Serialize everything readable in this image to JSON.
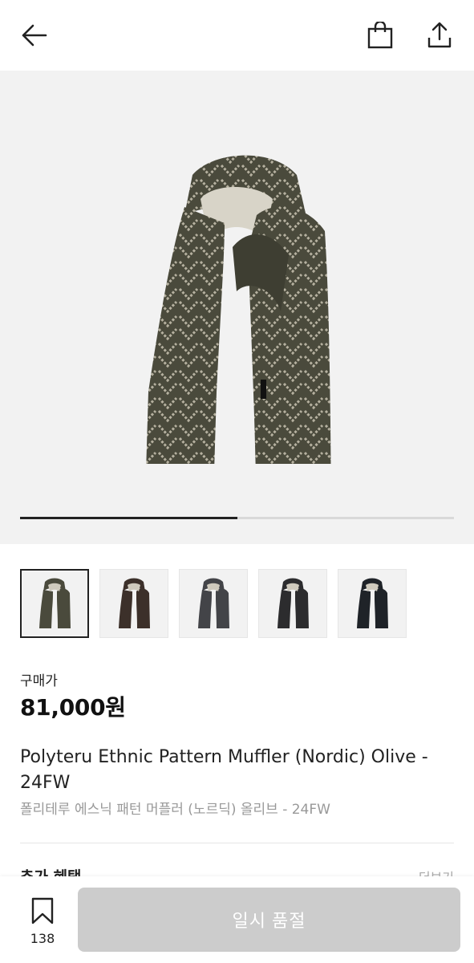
{
  "header": {
    "back_icon": "arrow-left-icon",
    "bag_icon": "shopping-bag-icon",
    "share_icon": "share-icon"
  },
  "gallery": {
    "current_image": 1,
    "image_count": 2,
    "progress": 0.5,
    "thumbnails": [
      {
        "name": "olive",
        "color": "#4a4a3c",
        "selected": true
      },
      {
        "name": "brown",
        "color": "#3c302a",
        "selected": false
      },
      {
        "name": "grey",
        "color": "#434448",
        "selected": false
      },
      {
        "name": "charcoal",
        "color": "#2c2c2e",
        "selected": false
      },
      {
        "name": "navy",
        "color": "#1f2328",
        "selected": false
      }
    ]
  },
  "product": {
    "price_label": "구매가",
    "price": "81,000원",
    "title_en": "Polyteru Ethnic Pattern Muffler (Nordic) Olive - 24FW",
    "title_ko": "폴리테루 에스닉 패턴 머플러 (노르딕) 올리브 - 24FW"
  },
  "benefits": {
    "title": "추가 혜택",
    "more_label": "더보기"
  },
  "bottom": {
    "wish_count": "138",
    "wish_icon": "bookmark-icon",
    "soldout_label": "일시 품절"
  },
  "colors": {
    "scarf_base": "#4a4a3c",
    "scarf_pattern": "#b5b09f",
    "button_disabled": "#cccccc"
  }
}
